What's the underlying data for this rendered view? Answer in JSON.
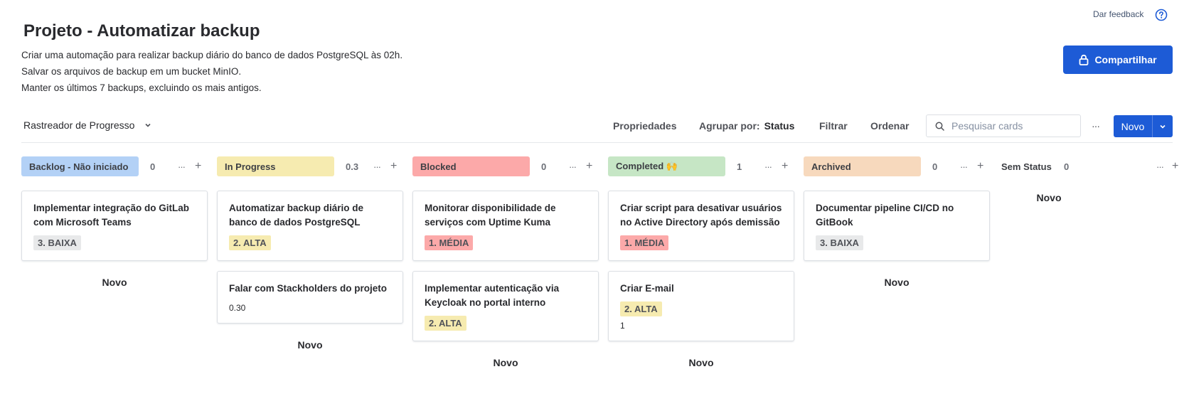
{
  "header": {
    "feedback": "Dar feedback",
    "title": "Projeto - Automatizar backup",
    "description": [
      "Criar uma automação para realizar backup diário do banco de dados PostgreSQL às 02h.",
      "Salvar os arquivos de backup em um bucket MinIO.",
      "Manter os últimos 7 backups, excluindo os mais antigos."
    ],
    "share_label": "Compartilhar"
  },
  "toolbar": {
    "view_label": "Rastreador de Progresso",
    "properties": "Propriedades",
    "group_by_label": "Agrupar por:",
    "group_by_value": "Status",
    "filter": "Filtrar",
    "sort": "Ordenar",
    "search_placeholder": "Pesquisar cards",
    "more": "···",
    "new_label": "Novo"
  },
  "colors": {
    "accent": "#1d5bd6",
    "backlog": "#b3d1f6",
    "in_progress": "#f6ebb0",
    "blocked": "#fca9a9",
    "completed": "#c6e6c5",
    "archived": "#f7d9bd",
    "tag_low": "#e8e9ea",
    "tag_high": "#f6ebb0",
    "tag_medium": "#fca9a9"
  },
  "columns": [
    {
      "name": "Backlog - Não iniciado",
      "count": "0",
      "more": "···",
      "add": "+",
      "new_label": "Novo",
      "cards": [
        {
          "title": "Implementar integração do GitLab com Microsoft Teams",
          "tag": "3. BAIXA"
        }
      ]
    },
    {
      "name": "In Progress",
      "count": "0.3",
      "more": "···",
      "add": "+",
      "new_label": "Novo",
      "cards": [
        {
          "title": "Automatizar backup diário de banco de dados PostgreSQL",
          "tag": "2. ALTA"
        },
        {
          "title": "Falar com Stackholders do projeto",
          "number": "0.30"
        }
      ]
    },
    {
      "name": "Blocked",
      "count": "0",
      "more": "···",
      "add": "+",
      "new_label": "Novo",
      "cards": [
        {
          "title": "Monitorar disponibilidade de serviços com Uptime Kuma",
          "tag": "1. MÉDIA"
        },
        {
          "title": "Implementar autenticação via Keycloak no portal interno",
          "tag": "2. ALTA"
        }
      ]
    },
    {
      "name": "Completed 🙌",
      "count": "1",
      "more": "···",
      "add": "+",
      "new_label": "Novo",
      "cards": [
        {
          "title": "Criar script para desativar usuários no Active Directory após demissão",
          "tag": "1. MÉDIA"
        },
        {
          "title": "Criar E-mail",
          "tag": "2. ALTA",
          "number": "1"
        }
      ]
    },
    {
      "name": "Archived",
      "count": "0",
      "more": "···",
      "add": "+",
      "new_label": "Novo",
      "cards": [
        {
          "title": "Documentar pipeline CI/CD no GitBook",
          "tag": "3. BAIXA"
        }
      ]
    },
    {
      "name": "Sem Status",
      "count": "0",
      "more": "···",
      "add": "+",
      "new_label": "Novo",
      "cards": []
    }
  ]
}
